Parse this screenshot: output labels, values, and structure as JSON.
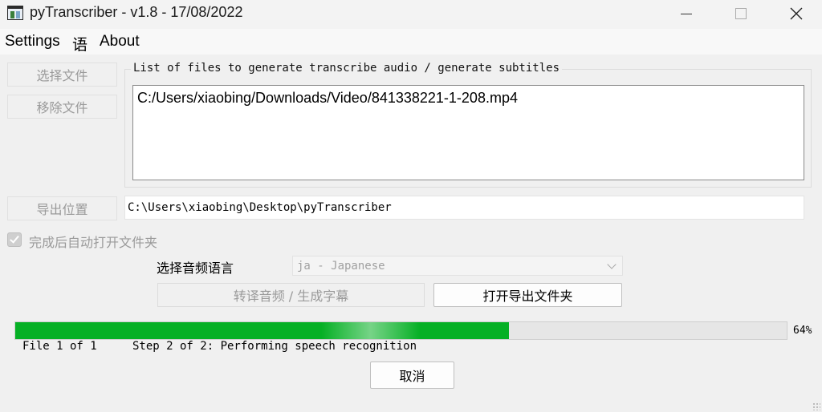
{
  "window": {
    "title": "pyTranscriber - v1.8 - 17/08/2022",
    "minimize_glyph": "—",
    "close_glyph": "✕"
  },
  "menu": {
    "settings": "Settings",
    "language": "语",
    "about": "About"
  },
  "sidebar": {
    "select_files": "选择文件",
    "remove_file": "移除文件"
  },
  "file_list": {
    "title": "List of files to generate transcribe audio / generate subtitles",
    "items": [
      "C:/Users/xiaobing/Downloads/Video/841338221-1-208.mp4"
    ]
  },
  "output": {
    "button": "导出位置",
    "path": "C:\\Users\\xiaobing\\Desktop\\pyTranscriber"
  },
  "auto_open": {
    "label": "完成后自动打开文件夹",
    "checked": true
  },
  "audio_language": {
    "label": "选择音频语言",
    "value": "ja - Japanese"
  },
  "actions": {
    "transcribe": "转译音频 / 生成字幕",
    "open_output": "打开导出文件夹",
    "cancel": "取消"
  },
  "progress": {
    "value": 64,
    "label": "64%",
    "file_status": "File 1 of 1",
    "step_status": "Step 2 of 2: Performing speech recognition"
  },
  "colors": {
    "progress_fill": "#06b025",
    "background": "#f0f0f0"
  }
}
